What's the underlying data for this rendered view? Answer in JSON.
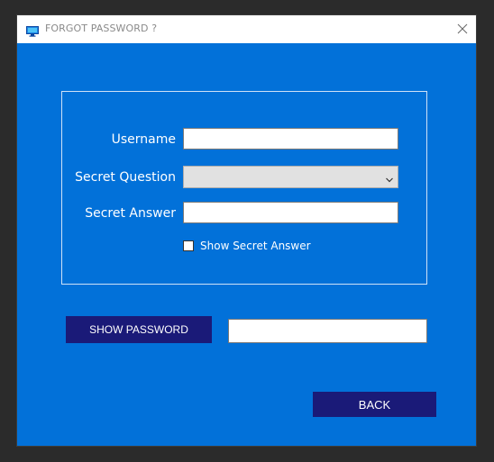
{
  "window": {
    "title": "FORGOT PASSWORD ?"
  },
  "form": {
    "username_label": "Username",
    "username_value": "",
    "secret_question_label": "Secret Question",
    "secret_question_value": "",
    "secret_answer_label": "Secret Answer",
    "secret_answer_value": "",
    "show_answer_label": "Show Secret Answer",
    "show_answer_checked": false
  },
  "actions": {
    "show_password_label": "SHOW PASSWORD",
    "password_output_value": "",
    "back_label": "BACK"
  },
  "icons": {
    "app": "monitor-icon",
    "close": "close-icon",
    "dropdown": "chevron-down-icon"
  },
  "colors": {
    "background": "#0271d9",
    "button": "#1a1a78",
    "titlebar": "#ffffff"
  }
}
